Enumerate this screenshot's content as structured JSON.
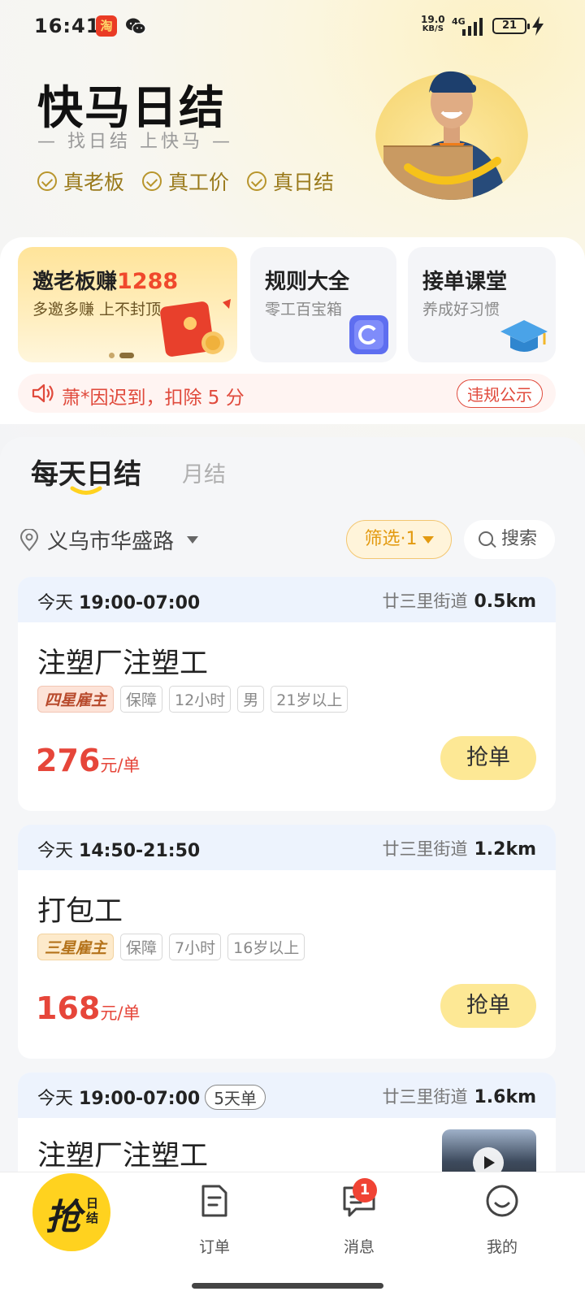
{
  "status_bar": {
    "time": "16:41",
    "app_icon_text": "淘",
    "speed_value": "19.0",
    "speed_unit": "KB/S",
    "network": "4G",
    "battery": "21"
  },
  "header": {
    "title": "快马日结",
    "slogan": "— 找日结 上快马 —",
    "badges": [
      "真老板",
      "真工价",
      "真日结"
    ]
  },
  "features": {
    "invite": {
      "title": "邀老板赚",
      "amount": "1288",
      "subtitle": "多邀多赚 上不封顶"
    },
    "rules": {
      "title": "规则大全",
      "subtitle": "零工百宝箱"
    },
    "course": {
      "title": "接单课堂",
      "subtitle": "养成好习惯"
    }
  },
  "notice": {
    "text": "萧*因迟到，扣除 5 分",
    "button": "违规公示"
  },
  "tabs": {
    "active": "每天日结",
    "inactive": "月结"
  },
  "location": {
    "text": "义乌市华盛路"
  },
  "filter": {
    "label": "筛选·1"
  },
  "search": {
    "label": "搜索"
  },
  "jobs": [
    {
      "day": "今天",
      "time": "19:00-07:00",
      "street": "廿三里街道",
      "distance": "0.5km",
      "name": "注塑厂注塑工",
      "star": "四星雇主",
      "tags": [
        "保障",
        "12小时",
        "男",
        "21岁以上"
      ],
      "price": "276",
      "unit": "元/单",
      "button": "抢单"
    },
    {
      "day": "今天",
      "time": "14:50-21:50",
      "street": "廿三里街道",
      "distance": "1.2km",
      "name": "打包工",
      "star": "三星雇主",
      "tags": [
        "保障",
        "7小时",
        "16岁以上"
      ],
      "price": "168",
      "unit": "元/单",
      "button": "抢单"
    },
    {
      "day": "今天",
      "time": "19:00-07:00",
      "extra_tag": "5天单",
      "street": "廿三里街道",
      "distance": "1.6km",
      "name": "注塑厂注塑工"
    }
  ],
  "bottom_nav": {
    "main_big": "抢",
    "main_small": "日结",
    "orders": "订单",
    "messages": "消息",
    "messages_badge": "1",
    "me": "我的"
  },
  "colors": {
    "accent_yellow": "#ffd21f",
    "price_red": "#e6463a",
    "badge_gold": "#9a7a1c",
    "filter_orange": "#e39a10"
  }
}
